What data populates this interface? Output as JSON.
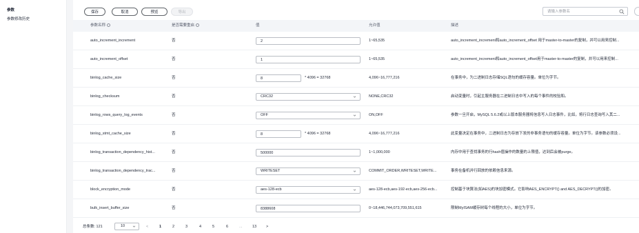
{
  "sidebar": {
    "items": [
      {
        "label": "参数",
        "active": true
      },
      {
        "label": "参数修改历史",
        "active": false
      }
    ]
  },
  "toolbar": {
    "save_label": "保存",
    "cancel_label": "取消",
    "preview_label": "预览",
    "export_label": "导出"
  },
  "search": {
    "placeholder": "请输入参数名"
  },
  "table": {
    "headers": {
      "name": "参数名称",
      "restart": "是否需要重启",
      "value": "值",
      "allowed": "允许值",
      "desc": "描述"
    },
    "rows": [
      {
        "name": "auto_increment_increment",
        "restart": "否",
        "value_type": "input",
        "value": "2",
        "unit": "",
        "allowed": "1~65,535",
        "desc": "auto_increment_increment和auto_increment_offset 用于master-to-master的复制，并可以用来控制..."
      },
      {
        "name": "auto_increment_offset",
        "restart": "否",
        "value_type": "input",
        "value": "1",
        "unit": "",
        "allowed": "1~65,535",
        "desc": "auto_increment_increment和auto_increment_offset用于master-to-master的复制，并可以用来控制..."
      },
      {
        "name": "binlog_cache_size",
        "restart": "否",
        "value_type": "input-short",
        "value": "8",
        "unit": "* 4096 = 32768",
        "allowed": "4,096~16,777,216",
        "desc": "在事务中，为二进制日志存储SQL语句的缓存容量。单位为字节。"
      },
      {
        "name": "binlog_checksum",
        "restart": "否",
        "value_type": "select",
        "value": "CRC32",
        "unit": "",
        "allowed": "NONE,CRC32",
        "desc": "启动变量时，引起主服务器在二进制日志中写入的每个事件的校验和。"
      },
      {
        "name": "binlog_rows_query_log_events",
        "restart": "否",
        "value_type": "select",
        "value": "OFF",
        "unit": "",
        "allowed": "ON,OFF",
        "desc": "参数一旦开启，MySQL 5.6.2或以上版本服务器将信息写入日志事件，比如，将行日志查询写入其二..."
      },
      {
        "name": "binlog_stmt_cache_size",
        "restart": "否",
        "value_type": "input-short",
        "value": "8",
        "unit": "* 4096 = 32768",
        "allowed": "4,096~16,777,216",
        "desc": "此变量决定在事务中，二进制日志为存放下发的非事务语句的缓存容量。单位为字节。该参数必须设..."
      },
      {
        "name": "binlog_transaction_dependency_hist...",
        "restart": "否",
        "value_type": "input",
        "value": "500000",
        "unit": "",
        "allowed": "1~1,000,000",
        "desc": "内存中用于查找事务的行hash值操作的数量的上限值，达到后会被purge。"
      },
      {
        "name": "binlog_transaction_dependency_trac...",
        "restart": "否",
        "value_type": "select",
        "value": "WRITESET",
        "unit": "",
        "allowed": "COMMIT_ORDER,WRITESET,WRITE...",
        "desc": "事务在备机并行回放的依赖信息来源。"
      },
      {
        "name": "block_encryption_mode",
        "restart": "否",
        "value_type": "select",
        "value": "aes-128-ecb",
        "unit": "",
        "allowed": "aes-128-ecb,aes-192-ecb,aes-256-ecb...",
        "desc": "控制基于块算法(如AES)的块加密模式。它影响AES_ENCRYPT() and AES_DECRYPT()的加密。"
      },
      {
        "name": "bulk_insert_buffer_size",
        "restart": "否",
        "value_type": "input",
        "value": "8388608",
        "unit": "",
        "allowed": "0~18,446,744,073,709,551,615",
        "desc": "限制MyISAM缓存树每个线程的大小，单位为字节。"
      }
    ]
  },
  "pagination": {
    "total_label": "总条数: 121",
    "page_size": "10",
    "prev": "<",
    "next": ">",
    "pages": [
      "1",
      "2",
      "3",
      "4",
      "5",
      "6",
      "...",
      "13"
    ],
    "active_page": "1"
  },
  "colors": {
    "accent": "#252b3a",
    "header_bg": "#f3f5f8",
    "border": "#b9bdc4",
    "disabled": "#b5b8be"
  }
}
